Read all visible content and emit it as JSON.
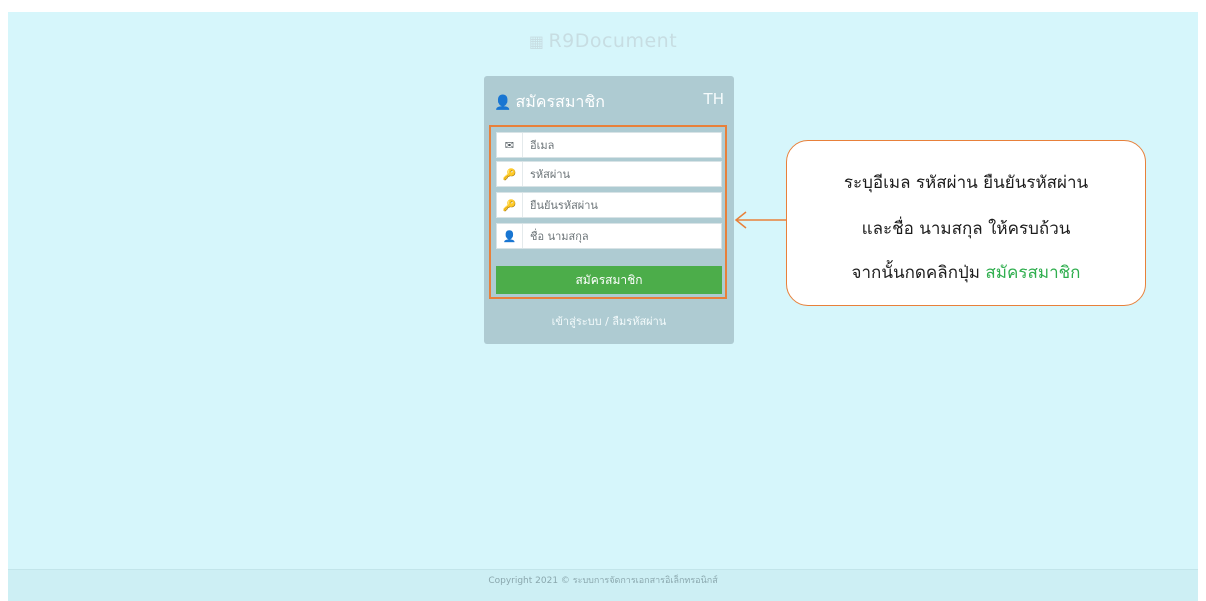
{
  "brand": {
    "icon": "books-icon",
    "icon_glyph": "▦",
    "name": "R9Document"
  },
  "card": {
    "header_icon": "user-add-icon",
    "header_icon_glyph": "👤",
    "title": "สมัครสมาชิก",
    "language": "TH"
  },
  "form": {
    "email": {
      "placeholder": "อีเมล",
      "icon": "envelope-icon",
      "glyph": "✉"
    },
    "password": {
      "placeholder": "รหัสผ่าน",
      "icon": "key-icon",
      "glyph": "🔑"
    },
    "confirm_password": {
      "placeholder": "ยืนยันรหัสผ่าน",
      "icon": "key-icon",
      "glyph": "🔑"
    },
    "full_name": {
      "placeholder": "ชื่อ นามสกุล",
      "icon": "user-icon",
      "glyph": "👤"
    },
    "submit_label": "สมัครสมาชิก",
    "login_link": "เข้าสู่ระบบ / ลืมรหัสผ่าน"
  },
  "callout": {
    "line1": "ระบุอีเมล รหัสผ่าน ยืนยันรหัสผ่าน",
    "line2": "และชื่อ นามสกุล ให้ครบถ้วน",
    "line3_prefix": "จากนั้นกดคลิกปุ่ม ",
    "line3_highlight": "สมัครสมาชิก"
  },
  "footer": {
    "text": "Copyright 2021 © ระบบการจัดการเอกสารอิเล็กทรอนิกส์"
  },
  "colors": {
    "page_background": "#d6f6fb",
    "card_background": "#aecbd2",
    "accent_green": "#4cad4a",
    "highlight_orange": "#e8803a"
  }
}
